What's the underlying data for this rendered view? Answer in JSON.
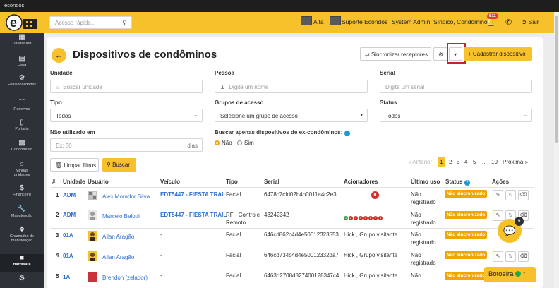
{
  "app": {
    "name": "econdos"
  },
  "topbar": {
    "search_placeholder": "Acesso rápido...",
    "condo_name": "Alfa",
    "support_label": "Suporte Econdos",
    "user_label": "System Admin, Síndico, Condômino",
    "notifications_count": "511",
    "logout_label": "Sair"
  },
  "sidebar": {
    "items": [
      {
        "label": "Dashboard",
        "icon": "bar-chart-icon"
      },
      {
        "label": "Feed",
        "icon": "newspaper-icon"
      },
      {
        "label": "Funcionalidades",
        "icon": "gears-icon"
      },
      {
        "label": "Reservas",
        "icon": "calendar-icon"
      },
      {
        "label": "Portaria",
        "icon": "mobile-icon"
      },
      {
        "label": "Condomínio",
        "icon": "building-icon"
      },
      {
        "label": "Minhas unidades",
        "icon": "home-icon"
      },
      {
        "label": "Financeiro",
        "icon": "dollar-icon"
      },
      {
        "label": "Manutenção",
        "icon": "wrench-icon"
      },
      {
        "label": "Chamados de manutenção",
        "icon": "tools-icon"
      },
      {
        "label": "Hardware",
        "icon": "hdd-icon"
      }
    ]
  },
  "page": {
    "title": "Dispositivos de condôminos",
    "sync_button": "Sincronizar receptores",
    "create_button": "Cadastrar dispositivo"
  },
  "filters": {
    "unit_label": "Unidade",
    "unit_placeholder": "Buscar unidade",
    "person_label": "Pessoa",
    "person_placeholder": "Digite um nome",
    "serial_label": "Serial",
    "serial_placeholder": "Digite um serial",
    "type_label": "Tipo",
    "type_value": "Todos",
    "groups_label": "Grupos de acesso",
    "groups_value": "Selecione um grupo de acesso",
    "status_label": "Status",
    "status_value": "Todos",
    "unused_label": "Não utilizado em",
    "unused_placeholder": "Ex: 30",
    "unused_suffix": "dias",
    "former_label": "Buscar apenas dispositivos de ex-condôminos:",
    "former_no": "Não",
    "former_yes": "Sim",
    "clear_button": "Limpar filtros",
    "search_button": "Buscar"
  },
  "pagination": {
    "prev": "« Anterior",
    "pages": [
      "1",
      "2",
      "3",
      "4",
      "5",
      "...",
      "10"
    ],
    "current": "1",
    "next": "Próxima »"
  },
  "table": {
    "headers": [
      "#",
      "Unidade",
      "Usuário",
      "Veículo",
      "Tipo",
      "Serial",
      "Acionadores",
      "Último uso",
      "Status",
      "Ações"
    ],
    "rows": [
      {
        "num": "1",
        "unit": "ADM",
        "user": "Alex Morador Silva",
        "vehicle": "EDT5447 - FIESTA TRAIL",
        "type": "Facial",
        "serial": "6478c7cfd02b4b0011a4c2e3",
        "triggers": "0",
        "last_use": "Não registrado",
        "status": "Não sincronizado"
      },
      {
        "num": "2",
        "unit": "ADM",
        "user": "Marcelo Belotti",
        "vehicle": "EDT5447 - FIESTA TRAIL",
        "type": "RF - Controle Remoto",
        "serial": "43242342",
        "triggers": [
          "1",
          "2",
          "3",
          "4",
          "5",
          "6",
          "7",
          "8"
        ],
        "last_use": "Não registrado",
        "status": "Não sincronizado"
      },
      {
        "num": "3",
        "unit": "01A",
        "user": "Allan Aragão",
        "vehicle": "-",
        "type": "Facial",
        "serial": "646cd862c4d4e50012323553",
        "triggers": "Hick , Grupo visitante",
        "last_use": "Não registrado",
        "status": "Não sincronizado"
      },
      {
        "num": "4",
        "unit": "01A",
        "user": "Allan Aragão",
        "vehicle": "-",
        "type": "Facial",
        "serial": "646cd734c4d4e50012332da7",
        "triggers": "Hick , Grupo visitante",
        "last_use": "Não registrado",
        "status": "Não sincronizado"
      },
      {
        "num": "5",
        "unit": "1A",
        "user": "Brendon (zelador)",
        "vehicle": "-",
        "type": "Facial",
        "serial": "6463d2708d827400128347c4",
        "triggers": "Hick , Grupo visitante",
        "last_use": "Não",
        "status": "Não sincronizado"
      }
    ]
  },
  "chat": {
    "count": "9"
  },
  "botoeira": {
    "label": "Botoeira"
  },
  "colors": {
    "brand_yellow": "#f7c12c",
    "sidebar_dark": "#2d3238",
    "status_orange": "#f0a500",
    "link_blue": "#2f6fd0",
    "highlight_red": "#c22626"
  }
}
